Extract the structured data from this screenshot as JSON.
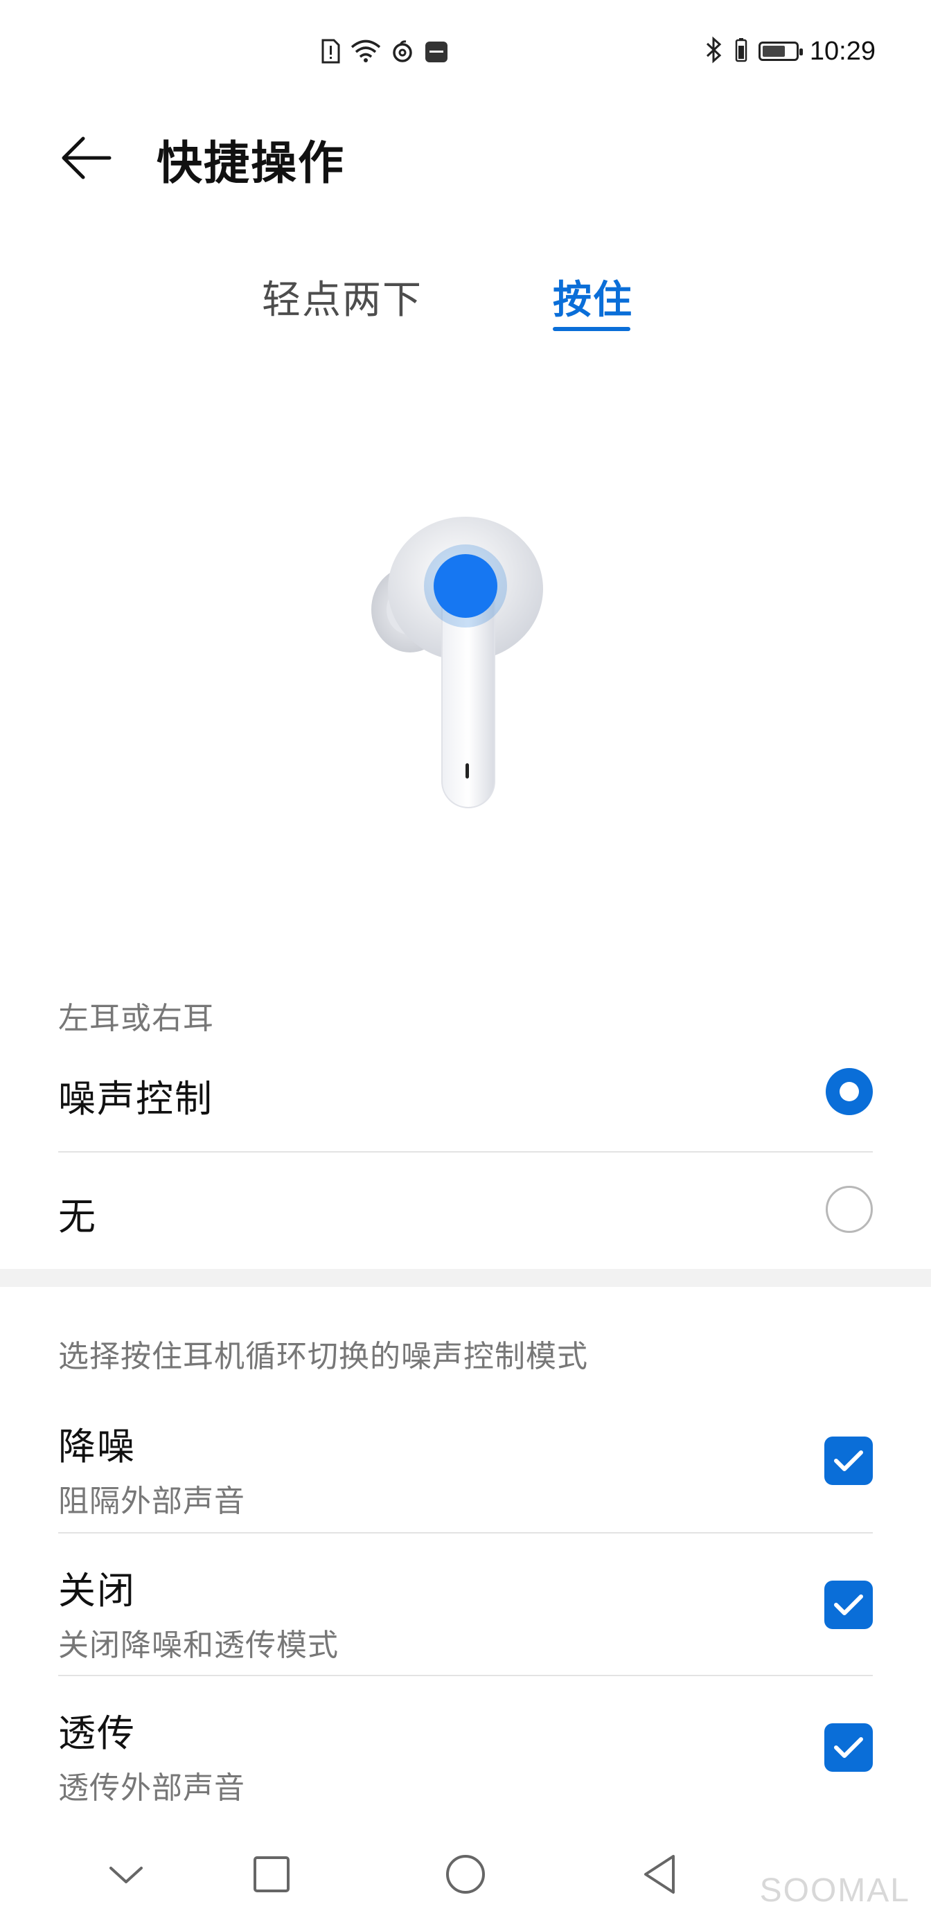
{
  "status_bar": {
    "time": "10:29",
    "icons": [
      "sim-alert-icon",
      "wifi-icon",
      "netease-music-icon",
      "huawei-app-icon",
      "bluetooth-icon",
      "battery-icon"
    ],
    "battery_level": 0.7
  },
  "header": {
    "title": "快捷操作",
    "back_icon": "arrow-left-icon"
  },
  "tabs": [
    {
      "label": "轻点两下",
      "active": false
    },
    {
      "label": "按住",
      "active": true
    }
  ],
  "side_section": {
    "label": "左耳或右耳",
    "options": [
      {
        "label": "噪声控制",
        "selected": true
      },
      {
        "label": "无",
        "selected": false
      }
    ]
  },
  "mode_section": {
    "label": "选择按住耳机循环切换的噪声控制模式",
    "modes": [
      {
        "title": "降噪",
        "subtitle": "阻隔外部声音",
        "checked": true
      },
      {
        "title": "关闭",
        "subtitle": "关闭降噪和透传模式",
        "checked": true
      },
      {
        "title": "透传",
        "subtitle": "透传外部声音",
        "checked": true
      }
    ]
  },
  "nav_bar": {
    "buttons": [
      "chevron-down-icon",
      "recents-square-icon",
      "home-circle-icon",
      "back-triangle-icon"
    ]
  },
  "watermark": "SOOMAL",
  "colors": {
    "accent": "#0a6ed8",
    "divider": "#e3e3e3",
    "section_gap": "#f2f2f2"
  }
}
